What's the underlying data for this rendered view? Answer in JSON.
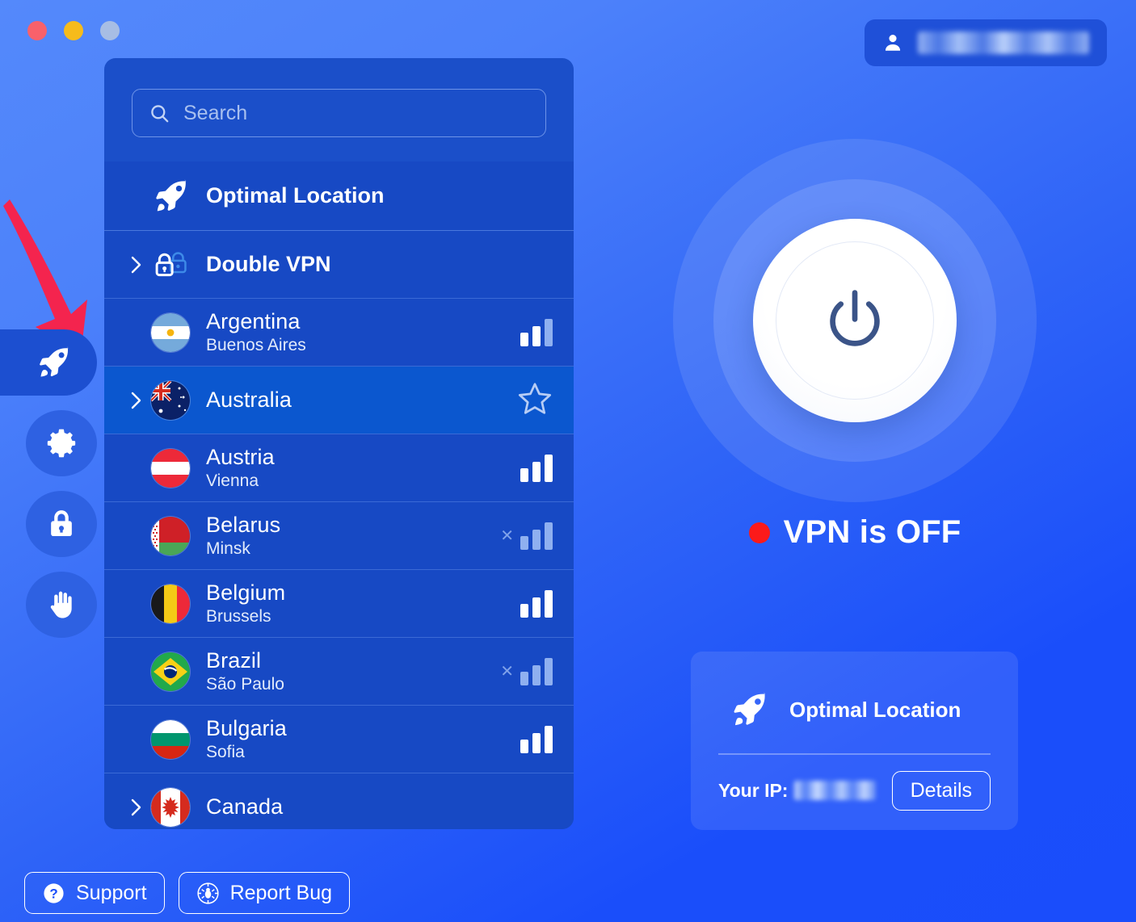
{
  "window": {
    "controls": [
      {
        "name": "close",
        "color": "#f8616b"
      },
      {
        "name": "minimize",
        "color": "#f6bb1b"
      },
      {
        "name": "maximize",
        "color": "#a7bde4"
      }
    ]
  },
  "account": {
    "icon": "person-icon",
    "name_masked": ""
  },
  "rail": {
    "items": [
      {
        "id": "locations",
        "icon": "rocket-icon",
        "active": true
      },
      {
        "id": "settings",
        "icon": "gear-icon",
        "active": false
      },
      {
        "id": "security",
        "icon": "lock-icon",
        "active": false
      },
      {
        "id": "block",
        "icon": "hand-icon",
        "active": false
      }
    ]
  },
  "search": {
    "placeholder": "Search",
    "value": "",
    "icon": "search-icon"
  },
  "list": {
    "optimal": {
      "label": "Optimal Location",
      "icon": "rocket-icon"
    },
    "double_vpn": {
      "label": "Double VPN",
      "icon": "double-lock-icon",
      "expandable": true
    },
    "countries": [
      {
        "name": "Argentina",
        "city": "Buenos Aires",
        "flag": "ar",
        "expandable": false,
        "signal": "medium",
        "unavailable": false,
        "favorite": false,
        "selected": false
      },
      {
        "name": "Australia",
        "city": "",
        "flag": "au",
        "expandable": true,
        "signal": "none",
        "unavailable": false,
        "favorite": true,
        "selected": true
      },
      {
        "name": "Austria",
        "city": "Vienna",
        "flag": "at",
        "expandable": false,
        "signal": "full",
        "unavailable": false,
        "favorite": false,
        "selected": false
      },
      {
        "name": "Belarus",
        "city": "Minsk",
        "flag": "by",
        "expandable": false,
        "signal": "off",
        "unavailable": true,
        "favorite": false,
        "selected": false
      },
      {
        "name": "Belgium",
        "city": "Brussels",
        "flag": "be",
        "expandable": false,
        "signal": "full",
        "unavailable": false,
        "favorite": false,
        "selected": false
      },
      {
        "name": "Brazil",
        "city": "São Paulo",
        "flag": "br",
        "expandable": false,
        "signal": "off",
        "unavailable": true,
        "favorite": false,
        "selected": false
      },
      {
        "name": "Bulgaria",
        "city": "Sofia",
        "flag": "bg",
        "expandable": false,
        "signal": "full",
        "unavailable": false,
        "favorite": false,
        "selected": false
      },
      {
        "name": "Canada",
        "city": "",
        "flag": "ca",
        "expandable": true,
        "signal": "none",
        "unavailable": false,
        "favorite": false,
        "selected": false
      }
    ]
  },
  "main": {
    "power_button": {
      "icon": "power-icon",
      "state": "off"
    },
    "status_text": "VPN is OFF",
    "status_color": "#fc1a1a",
    "location_card": {
      "icon": "rocket-icon",
      "label": "Optimal Location",
      "ip_label": "Your IP:",
      "ip_value_masked": "",
      "details_label": "Details"
    }
  },
  "footer": {
    "support_label": "Support",
    "support_icon": "question-circle-icon",
    "report_bug_label": "Report Bug",
    "report_bug_icon": "bug-icon"
  },
  "annotation": {
    "arrow_color": "#f4244e",
    "points_to": "rail-item-locations"
  }
}
